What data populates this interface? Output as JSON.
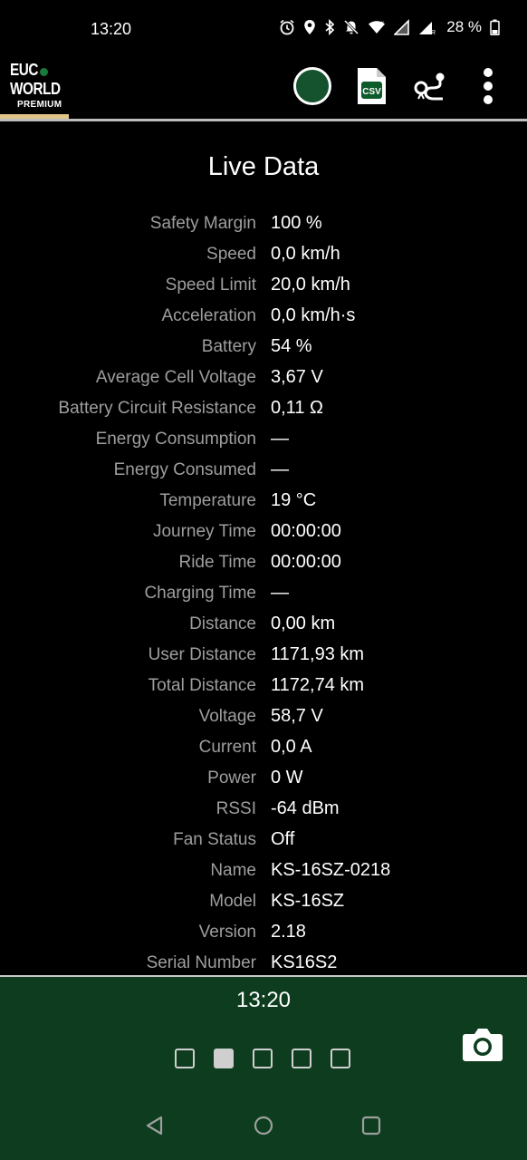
{
  "status_bar": {
    "time": "13:20",
    "icons": [
      "alarm-icon",
      "location-icon",
      "bluetooth-icon",
      "mute-icon",
      "wifi-icon",
      "signal-x-icon",
      "signal-r-icon"
    ],
    "battery_percent": "28 %"
  },
  "app_bar": {
    "logo_line1": "EUC",
    "logo_line2": "WORLD",
    "logo_tag": "PREMIUM",
    "logo_accent": "#e0c488",
    "connect_color": "#14532d",
    "csv_label": "CSV"
  },
  "live_data": {
    "title": "Live Data",
    "rows": [
      {
        "label": "Safety Margin",
        "value": "100 %"
      },
      {
        "label": "Speed",
        "value": "0,0 km/h"
      },
      {
        "label": "Speed Limit",
        "value": "20,0 km/h"
      },
      {
        "label": "Acceleration",
        "value": "0,0 km/h·s"
      },
      {
        "label": "Battery",
        "value": "54 %"
      },
      {
        "label": "Average Cell Voltage",
        "value": "3,67 V"
      },
      {
        "label": "Battery Circuit Resistance",
        "value": "0,11 Ω"
      },
      {
        "label": "Energy Consumption",
        "value": "—"
      },
      {
        "label": "Energy Consumed",
        "value": "—"
      },
      {
        "label": "Temperature",
        "value": "19 °C"
      },
      {
        "label": "Journey Time",
        "value": "00:00:00"
      },
      {
        "label": "Ride Time",
        "value": "00:00:00"
      },
      {
        "label": "Charging Time",
        "value": "—"
      },
      {
        "label": "Distance",
        "value": "0,00 km"
      },
      {
        "label": "User Distance",
        "value": "1171,93 km"
      },
      {
        "label": "Total Distance",
        "value": "1172,74 km"
      },
      {
        "label": "Voltage",
        "value": "58,7 V"
      },
      {
        "label": "Current",
        "value": "0,0 A"
      },
      {
        "label": "Power",
        "value": "0 W"
      },
      {
        "label": "RSSI",
        "value": "-64 dBm"
      },
      {
        "label": "Fan Status",
        "value": "Off"
      },
      {
        "label": "Name",
        "value": "KS-16SZ-0218"
      },
      {
        "label": "Model",
        "value": "KS-16SZ"
      },
      {
        "label": "Version",
        "value": "2.18"
      },
      {
        "label": "Serial Number",
        "value": "KS16S2"
      }
    ]
  },
  "bottom_panel": {
    "time": "13:20",
    "page_count": 5,
    "active_page": 2,
    "background": "#0d3d1e"
  }
}
